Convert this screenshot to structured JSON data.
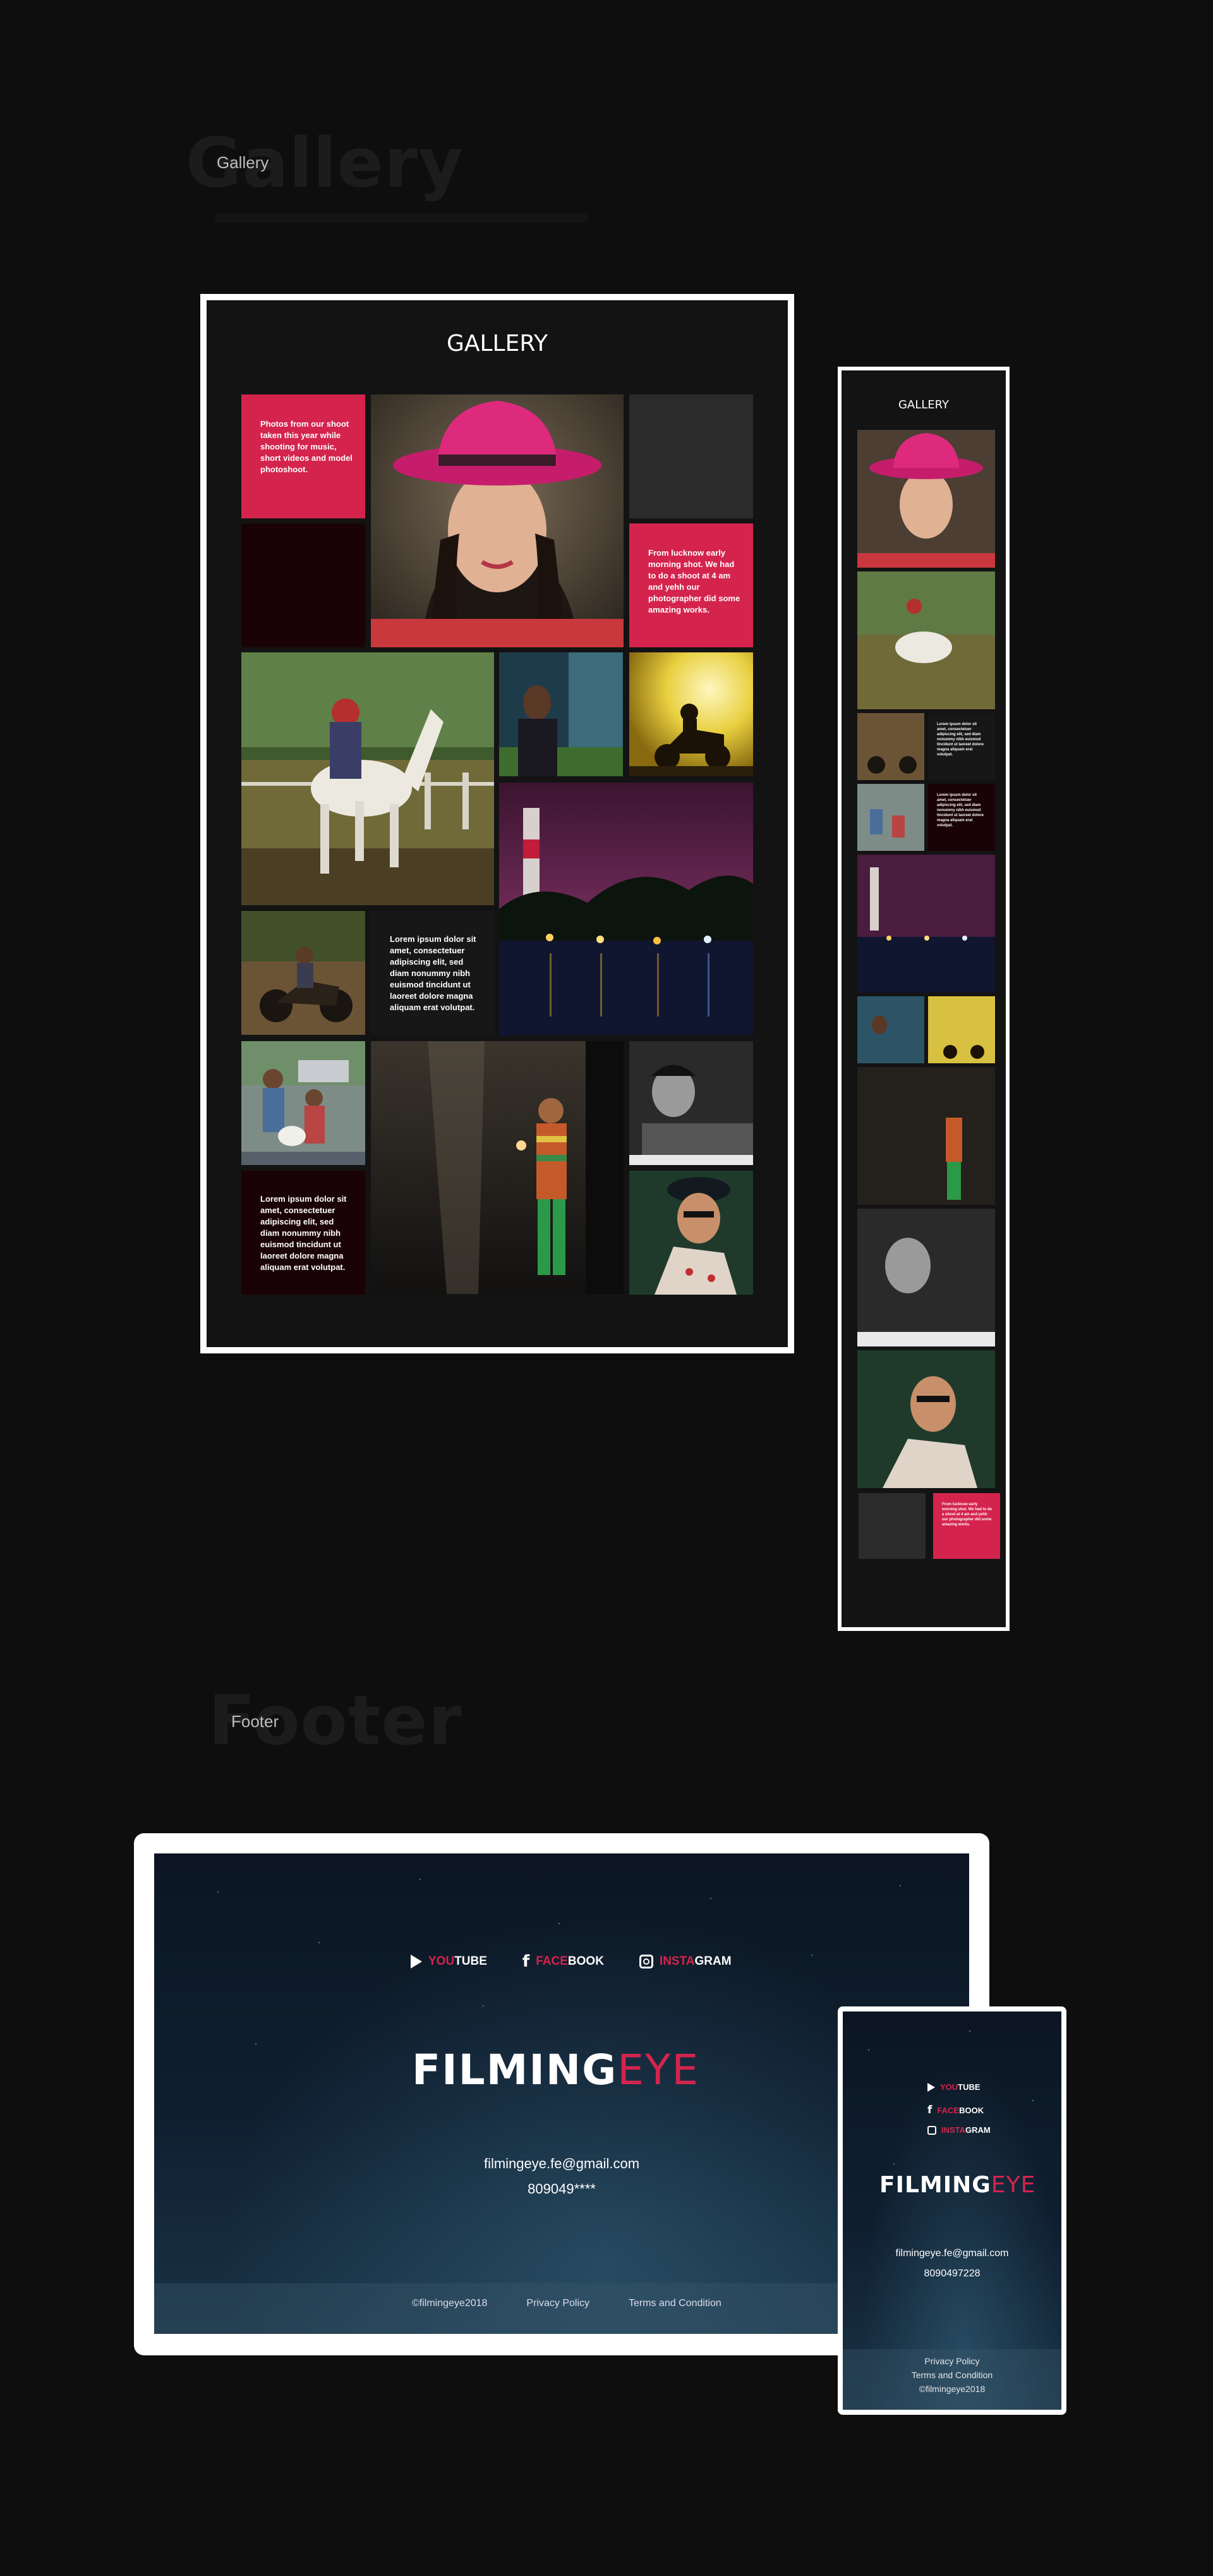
{
  "gallery_section": {
    "ghost": "Gallery",
    "label": "Gallery"
  },
  "desktop_gallery": {
    "title": "GALLERY",
    "tile_red_1": "Photos from our shoot taken this year while shooting for music, short videos and model photoshoot.",
    "tile_red_2": "From lucknow early morning shot. We had to do a shoot at 4 am and yehh our photographer did some amazing works.",
    "tile_text_dark": "Lorem ipsum dolor sit amet, consectetuer adipiscing elit, sed diam nonummy nibh euismod tincidunt ut laoreet dolore magna aliquam erat volutpat.",
    "tile_text_maroon": "Lorem ipsum dolor sit amet, consectetuer adipiscing elit, sed diam nonummy nibh euismod tincidunt ut laoreet dolore magna aliquam erat volutpat."
  },
  "mobile_gallery": {
    "title": "GALLERY",
    "text_1": "Lorem ipsum dolor sit amet, consectetuer adipiscing elit, sed diam nonummy nibh euismod tincidunt ut laoreet dolore magna aliquam erat volutpat.",
    "text_2": "Lorem ipsum dolor sit amet, consectetuer adipiscing elit, sed diam nonummy nibh euismod tincidunt ut laoreet dolore magna aliquam erat volutpat.",
    "text_red": "From lucknow early morning shot. We had to do a shoot at 4 am and yehh our photographer did some amazing works."
  },
  "footer_section": {
    "ghost": "Footer",
    "label": "Footer"
  },
  "footer_desktop": {
    "youtube_hl": "YOU",
    "youtube_rest": "TUBE",
    "facebook_hl": "FACE",
    "facebook_rest": "BOOK",
    "instagram_hl": "INSTA",
    "instagram_rest": "GRAM",
    "brand_main": "FILMING",
    "brand_accent": "EYE",
    "email": "filmingeye.fe@gmail.com",
    "phone": "809049****",
    "copyright": "©filmingeye2018",
    "privacy": "Privacy Policy",
    "terms": "Terms and Condition"
  },
  "footer_mobile": {
    "youtube_hl": "YOU",
    "youtube_rest": "TUBE",
    "facebook_hl": "FACE",
    "facebook_rest": "BOOK",
    "instagram_hl": "INSTA",
    "instagram_rest": "GRAM",
    "brand_main": "FILMING",
    "brand_accent": "EYE",
    "email": "filmingeye.fe@gmail.com",
    "phone": "8090497228",
    "privacy": "Privacy Policy",
    "terms": "Terms and Condition",
    "copyright": "©filmingeye2018"
  },
  "colors": {
    "accent": "#d4244e",
    "background": "#0e0e0e",
    "panel": "#131313"
  }
}
